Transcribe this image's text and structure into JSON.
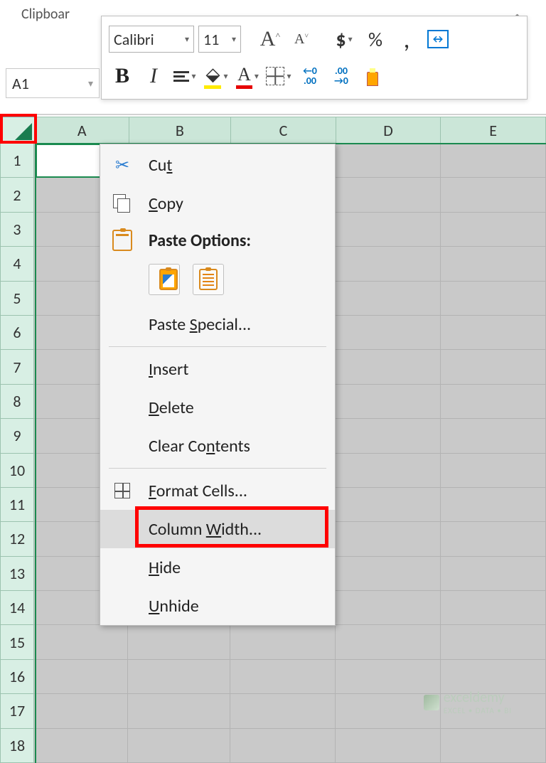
{
  "ribbon": {
    "clipboard_group": "Clipboar"
  },
  "collapse_icon": "⌄",
  "mini_toolbar": {
    "font_name": "Calibri",
    "font_size": "11"
  },
  "namebox": {
    "value": "A1"
  },
  "columns": [
    "A",
    "B",
    "C",
    "D",
    "E"
  ],
  "rows": [
    "1",
    "2",
    "3",
    "4",
    "5",
    "6",
    "7",
    "8",
    "9",
    "10",
    "11",
    "12",
    "13",
    "14",
    "15",
    "16",
    "17",
    "18"
  ],
  "context_menu": {
    "cut": "Cut",
    "cut_accel": "t",
    "copy": "Copy",
    "copy_accel": "C",
    "paste_options": "Paste Options:",
    "paste_special": "Paste Special...",
    "paste_special_accel": "S",
    "insert": "Insert",
    "insert_accel": "I",
    "delete": "Delete",
    "delete_accel": "D",
    "clear_contents": "Clear Contents",
    "clear_accel": "n",
    "format_cells": "Format Cells...",
    "format_accel": "F",
    "column_width": "Column Width...",
    "colw_accel": "W",
    "hide": "Hide",
    "hide_accel": "H",
    "unhide": "Unhide",
    "unhide_accel": "U"
  },
  "watermark": {
    "brand": "exceldemy",
    "tag": "EXCEL • DATA • BI"
  }
}
